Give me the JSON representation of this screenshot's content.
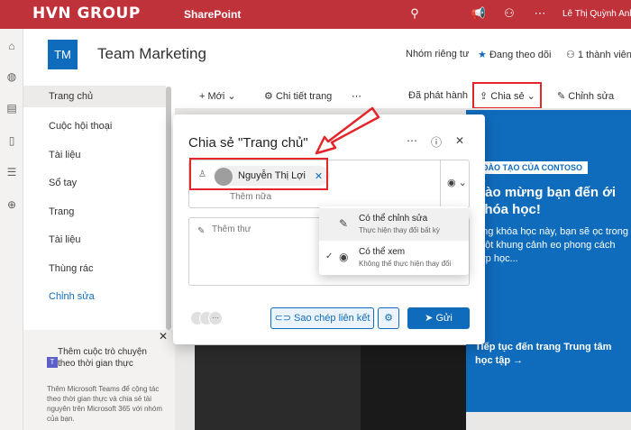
{
  "topbar": {
    "brand": "HVN GROUP",
    "brand_mark": "W",
    "app_name": "SharePoint",
    "user_name": "Lê Thị Quỳnh Anh",
    "accent": "#c0323a"
  },
  "site": {
    "logo_text": "TM",
    "title": "Team Marketing",
    "privacy": "Nhóm riêng tư",
    "following": "Đang theo dõi",
    "members": "1 thành viên"
  },
  "nav": {
    "items": [
      "Trang chủ",
      "Cuộc hội thoại",
      "Tài liệu",
      "Sổ tay",
      "Trang",
      "Tài liệu",
      "Thùng rác"
    ],
    "edit": "Chỉnh sửa"
  },
  "teams_promo": {
    "title": "Thêm cuộc trò chuyện theo thời gian thực",
    "desc": "Thêm Microsoft Teams để cộng tác theo thời gian thực và chia sẻ tài nguyên trên Microsoft 365 với nhóm của bạn."
  },
  "cmdbar": {
    "new": "Mới",
    "page_details": "Chi tiết trang",
    "published": "Đã phát hành",
    "share": "Chia sẻ",
    "edit": "Chỉnh sửa"
  },
  "hero": {
    "tag": "ĐÀO TẠO CỦA CONTOSO",
    "title": "hào mừng bạn đến ới khóa học!",
    "desc": "ong khóa học này, bạn sẽ ọc trong một khung cảnh eo phong cách lớp học...",
    "link": "Tiếp tục đến trang Trung tâm học tập →"
  },
  "dialog": {
    "title": "Chia sẻ \"Trang chủ\"",
    "recipient": "Nguyễn Thị Lợi",
    "add_more_placeholder": "Thêm nữa",
    "message_placeholder": "Thêm thư",
    "copy_link": "Sao chép liên kết",
    "send": "Gửi"
  },
  "permissions": [
    {
      "title": "Có thể chỉnh sửa",
      "desc": "Thực hiện thay đổi bất kỳ",
      "selected": true
    },
    {
      "title": "Có thể xem",
      "desc": "Không thể thực hiện thay đổi",
      "selected": false
    }
  ]
}
